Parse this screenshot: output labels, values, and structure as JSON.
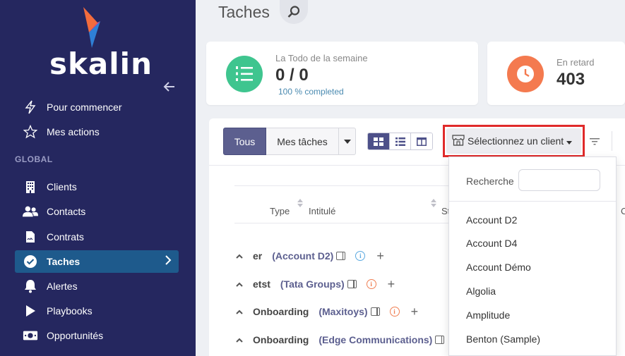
{
  "sidebar": {
    "logo_text": "skalin",
    "section_global": "GLOBAL",
    "items": [
      {
        "label": "Pour commencer",
        "icon": "bolt-icon"
      },
      {
        "label": "Mes actions",
        "icon": "star-icon"
      },
      {
        "label": "Clients",
        "icon": "building-icon"
      },
      {
        "label": "Contacts",
        "icon": "users-icon"
      },
      {
        "label": "Contrats",
        "icon": "file-signature-icon"
      },
      {
        "label": "Taches",
        "icon": "check-circle-icon",
        "active": true
      },
      {
        "label": "Alertes",
        "icon": "bell-icon"
      },
      {
        "label": "Playbooks",
        "icon": "play-icon"
      },
      {
        "label": "Opportunités",
        "icon": "money-icon"
      }
    ]
  },
  "header": {
    "title": "Taches"
  },
  "cards": {
    "todo": {
      "label": "La Todo de la semaine",
      "value": "0 / 0",
      "sub": "100 % completed",
      "color": "#3fc58f"
    },
    "late": {
      "label": "En retard",
      "value": "403",
      "color": "#f47a4f"
    }
  },
  "toolbar": {
    "tous": "Tous",
    "mes_taches": "Mes tâches",
    "client_select": "Sélectionnez un client"
  },
  "table": {
    "headers": {
      "type": "Type",
      "intitule": "Intitulé",
      "status": "St",
      "next": "C"
    },
    "rows": [
      {
        "name": "er",
        "client": "(Account D2)",
        "info": "blue"
      },
      {
        "name": "etst",
        "client": "(Tata Groups)",
        "info": "orange"
      },
      {
        "name": "Onboarding",
        "client": "(Maxitoys)",
        "info": "orange"
      },
      {
        "name": "Onboarding",
        "client": "(Edge Communications)",
        "info": "none"
      }
    ]
  },
  "dropdown": {
    "search_label": "Recherche",
    "search_value": "",
    "options": [
      "Account D2",
      "Account D4",
      "Account Démo",
      "Algolia",
      "Amplitude",
      "Benton (Sample)"
    ]
  },
  "colors": {
    "sidebar_bg": "#25275f",
    "active_item": "#1e5a8c",
    "highlight": "#e02a2a"
  }
}
